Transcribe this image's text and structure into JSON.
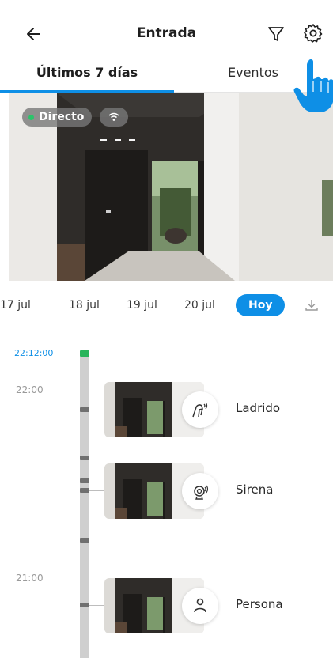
{
  "header": {
    "title": "Entrada",
    "back_icon": "arrow-left-icon",
    "filter_icon": "filter-icon",
    "settings_icon": "gear-icon"
  },
  "tabs": [
    {
      "label": "Últimos 7 días",
      "active": true
    },
    {
      "label": "Eventos",
      "active": false
    }
  ],
  "camera": {
    "live_label": "Directo",
    "live_dot_color": "#2bc46a",
    "signal_icon": "wifi-icon"
  },
  "dates": {
    "items": [
      "17 jul",
      "18 jul",
      "19 jul",
      "20 jul"
    ],
    "today_label": "Hoy",
    "download_icon": "download-icon"
  },
  "timeline": {
    "now_time": "22:12:00",
    "hours": [
      "22:00",
      "21:00"
    ],
    "accent": "#0e8fe6",
    "now_marker_color": "#27b45a"
  },
  "events": [
    {
      "label": "Ladrido",
      "icon": "dog-bark-icon"
    },
    {
      "label": "Sirena",
      "icon": "siren-icon"
    },
    {
      "label": "Persona",
      "icon": "person-icon"
    }
  ]
}
